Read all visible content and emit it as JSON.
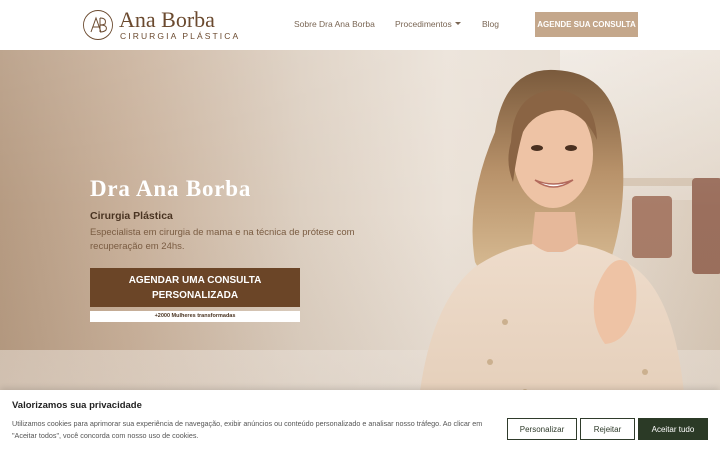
{
  "header": {
    "logo": {
      "name": "Ana Borba",
      "tagline": "CIRURGIA PLÁSTICA",
      "monogram": "AB"
    },
    "nav": {
      "about": "Sobre Dra Ana Borba",
      "procedures": "Procedimentos",
      "blog": "Blog"
    },
    "cta": "AGENDE SUA CONSULTA"
  },
  "hero": {
    "title": "Dra Ana Borba",
    "subtitle": "Cirurgia Plástica",
    "description": "Especialista em cirurgia de mama e na técnica de prótese com recuperação em 24hs.",
    "cta": "AGENDAR UMA CONSULTA PERSONALIZADA",
    "badge": "+2000 Mulheres transformadas"
  },
  "cookie_banner": {
    "title": "Valorizamos sua privacidade",
    "text": "Utilizamos cookies para aprimorar sua experiência de navegação, exibir anúncios ou conteúdo personalizado e analisar nosso tráfego. Ao clicar em \"Aceitar todos\", você concorda com nosso uso de cookies.",
    "customize": "Personalizar",
    "reject": "Rejeitar",
    "accept": "Aceitar tudo"
  },
  "colors": {
    "brand_brown": "#6b4a2f",
    "cta_tan": "#c4a78b",
    "cta_dark": "#6b4527",
    "accept_green": "#2b3a26"
  }
}
